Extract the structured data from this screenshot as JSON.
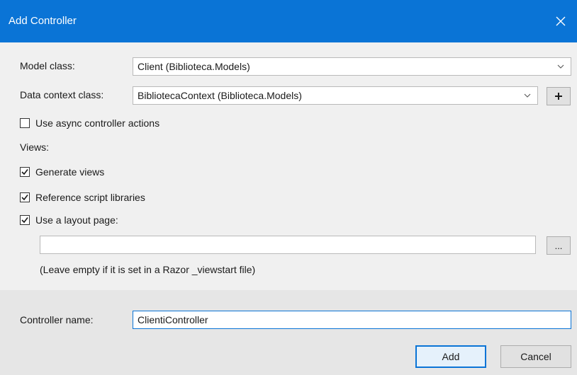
{
  "window": {
    "title": "Add Controller",
    "close_glyph": "✕"
  },
  "model_class": {
    "label": "Model class:",
    "value": "Client (Biblioteca.Models)"
  },
  "data_context_class": {
    "label": "Data context class:",
    "value": "BibliotecaContext (Biblioteca.Models)",
    "add_button": "+"
  },
  "async_actions": {
    "label": "Use async controller actions",
    "checked": false
  },
  "views": {
    "label": "Views:",
    "generate_views": {
      "label": "Generate views",
      "checked": true
    },
    "reference_scripts": {
      "label": "Reference script libraries",
      "checked": true
    },
    "use_layout": {
      "label": "Use a layout page:",
      "checked": true
    },
    "layout_path": {
      "value": ""
    },
    "browse_button": "...",
    "hint": "(Leave empty if it is set in a Razor _viewstart file)"
  },
  "controller_name": {
    "label": "Controller name:",
    "value": "ClientiController"
  },
  "buttons": {
    "add": "Add",
    "cancel": "Cancel"
  },
  "colors": {
    "accent": "#0a74d6",
    "content_bg": "#f0f0f0",
    "footer_bg": "#e6e6e6"
  }
}
